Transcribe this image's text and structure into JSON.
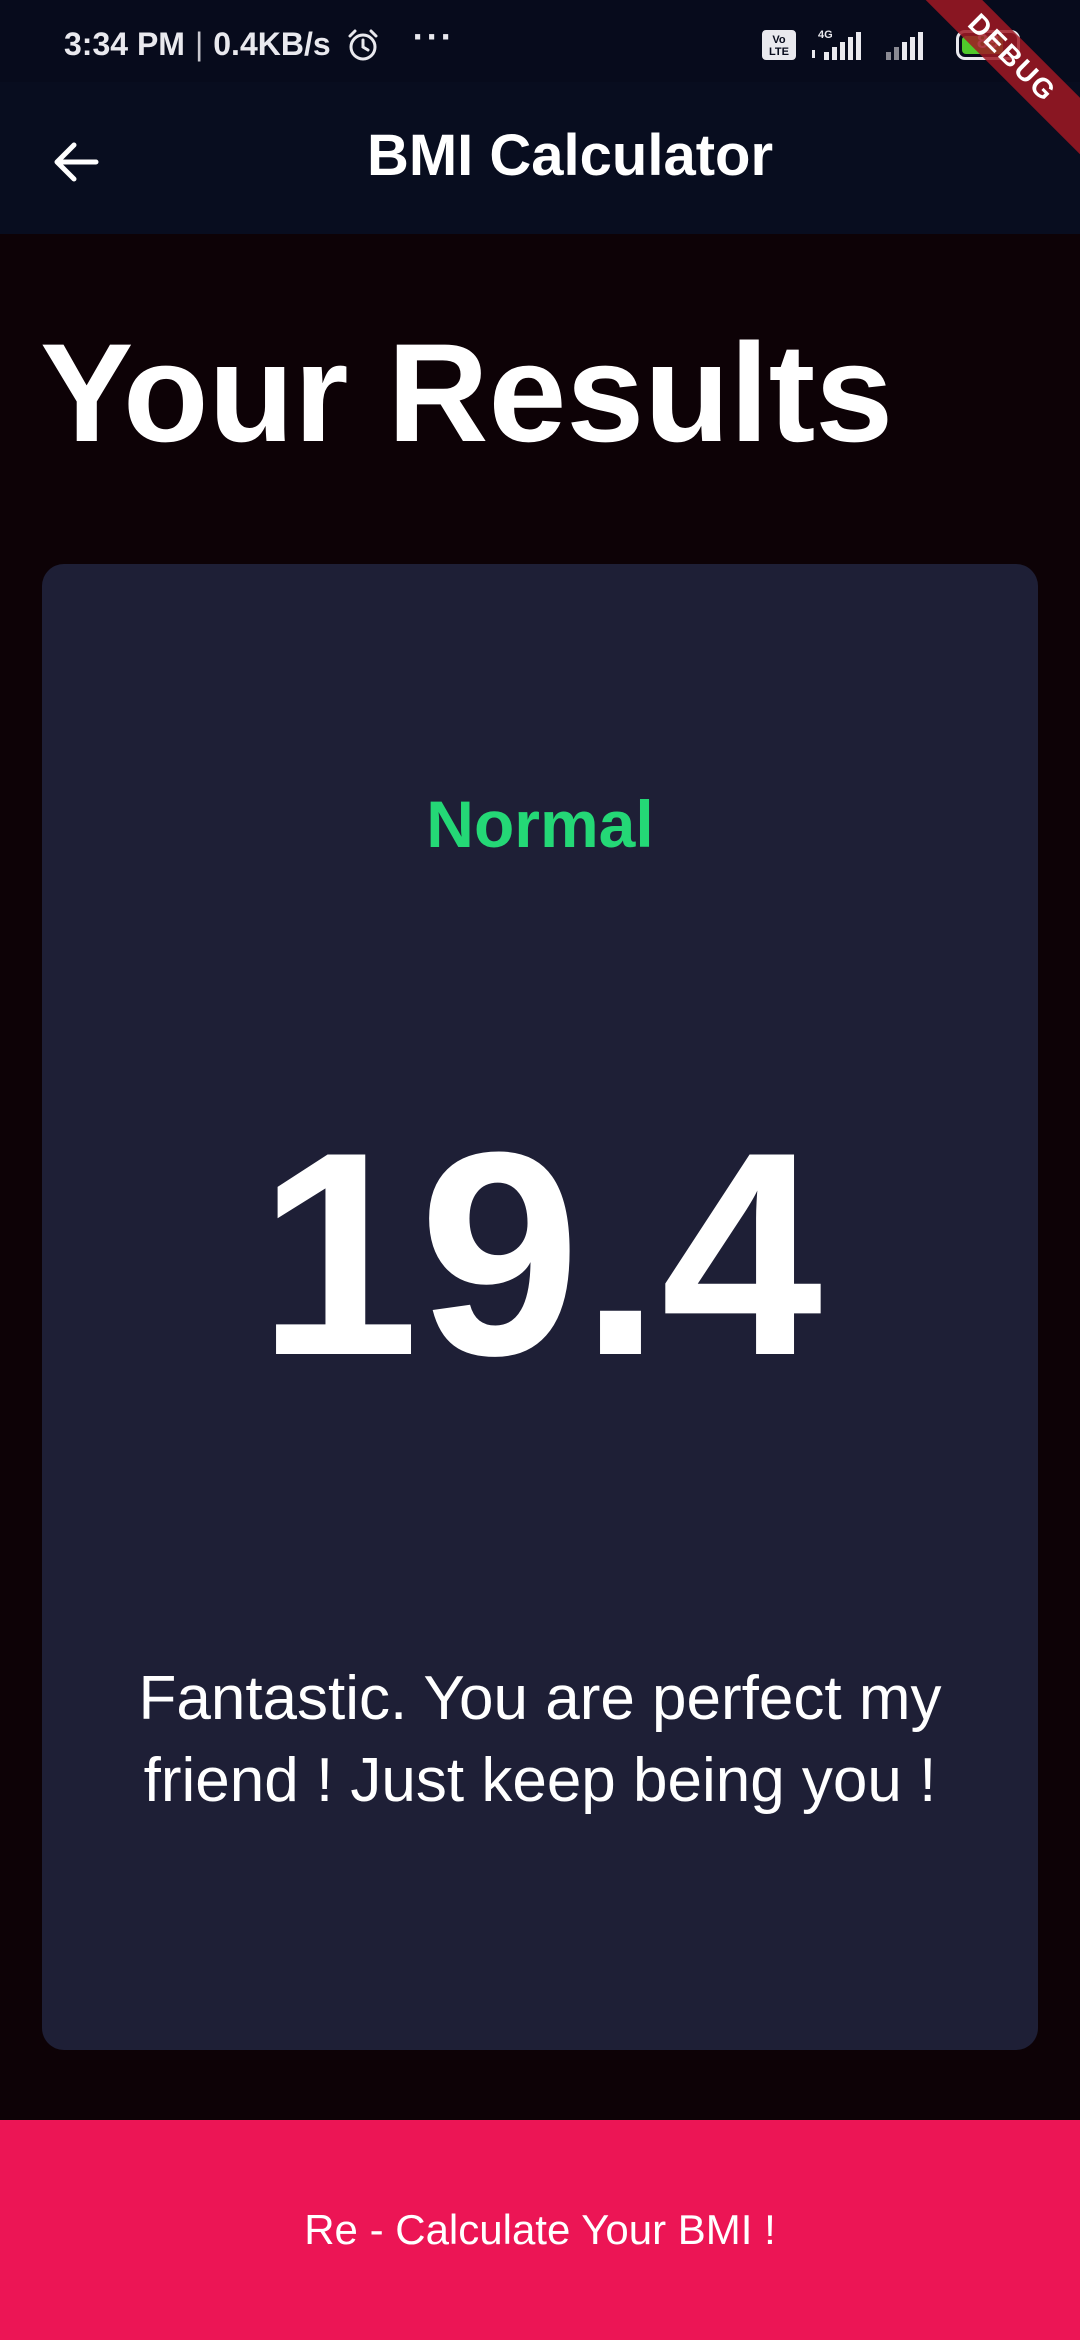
{
  "status_bar": {
    "time": "3:34 PM",
    "separator": "|",
    "data_speed": "0.4KB/s",
    "more": "···",
    "volte": "Vo LTE",
    "network": "4G",
    "battery_level": "89",
    "battery_color": "#4fc92b"
  },
  "debug_banner": "DEBUG",
  "app_bar": {
    "back_icon": "arrow-back-icon",
    "title": "BMI Calculator"
  },
  "page": {
    "title": "Your Results"
  },
  "result": {
    "status": "Normal",
    "status_color": "#24d876",
    "bmi_value": "19.4",
    "message": "Fantastic. You are perfect my friend ! Just keep being you !"
  },
  "recalculate_button": {
    "label": "Re - Calculate Your BMI !",
    "color": "#ec1555"
  }
}
